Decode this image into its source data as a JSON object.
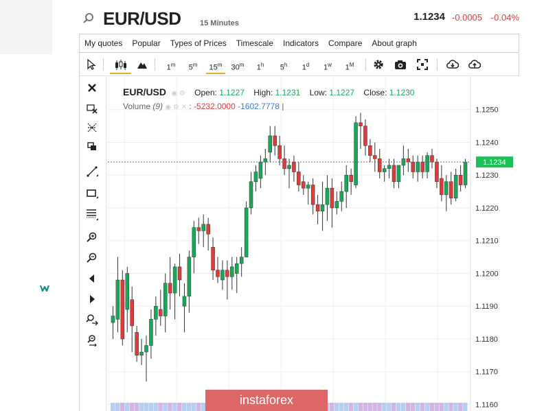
{
  "header": {
    "symbol": "EUR/USD",
    "timeframe": "15 Minutes",
    "price": "1.1234",
    "change": "-0.0005",
    "change_pct": "-0.04%"
  },
  "menu": [
    "My quotes",
    "Popular",
    "Types of Prices",
    "Timescale",
    "Indicators",
    "Compare",
    "About graph"
  ],
  "toolbar": {
    "timeframes": [
      {
        "base": "1",
        "sup": "m"
      },
      {
        "base": "5",
        "sup": "m"
      },
      {
        "base": "15",
        "sup": "m"
      },
      {
        "base": "30",
        "sup": "m"
      },
      {
        "base": "1",
        "sup": "h"
      },
      {
        "base": "5",
        "sup": "h"
      },
      {
        "base": "1",
        "sup": "d"
      },
      {
        "base": "1",
        "sup": "w"
      },
      {
        "base": "1",
        "sup": "M"
      }
    ],
    "active_timeframe": "15m",
    "icons": [
      "cursor-icon",
      "candlestick-icon",
      "mountain-icon",
      "gear-icon",
      "camera-icon",
      "fullscreen-icon",
      "download-icon",
      "upload-icon"
    ]
  },
  "left_tools": [
    "close-icon",
    "erase-icon",
    "crosshair-icon",
    "clone-icon",
    "trendline-icon",
    "rectangle-icon",
    "fibonacci-icon",
    "zoom-in-icon",
    "zoom-out-icon",
    "scroll-left-icon",
    "scroll-right-icon",
    "zoom-in-left-icon",
    "zoom-reset-icon"
  ],
  "legend": {
    "symbol": "EUR/USD",
    "open_label": "Open:",
    "open": "1.1227",
    "high_label": "High:",
    "high": "1.1231",
    "low_label": "Low:",
    "low": "1.1227",
    "close_label": "Close:",
    "close": "1.1230",
    "volume_label": "Volume",
    "volume_param": "(9)",
    "volume_sep": ":",
    "volume_value1": "-5232.0000",
    "volume_value2": "-1602.7778",
    "volume_cursor": "|"
  },
  "watermark": "instaforex",
  "colors": {
    "up": "#1aa75a",
    "down": "#e03a3a",
    "price_tag": "#1fbf58",
    "active_underline": "#e6a935"
  },
  "chart_data": {
    "type": "candlestick",
    "y_ticks": [
      "1.1250",
      "1.1240",
      "1.1230",
      "1.1220",
      "1.1210",
      "1.1200",
      "1.1190",
      "1.1180",
      "1.1170",
      "1.1160"
    ],
    "ylim": [
      1.1158,
      1.126
    ],
    "current_price": "1.1234",
    "grid": true,
    "candles": [
      {
        "o": 1.1185,
        "h": 1.119,
        "l": 1.118,
        "c": 1.1187
      },
      {
        "o": 1.1186,
        "h": 1.1205,
        "l": 1.1182,
        "c": 1.1198
      },
      {
        "o": 1.1198,
        "h": 1.1201,
        "l": 1.1178,
        "c": 1.118
      },
      {
        "o": 1.1189,
        "h": 1.1202,
        "l": 1.1182,
        "c": 1.12
      },
      {
        "o": 1.1192,
        "h": 1.1196,
        "l": 1.1176,
        "c": 1.1184
      },
      {
        "o": 1.1182,
        "h": 1.1184,
        "l": 1.1173,
        "c": 1.1175
      },
      {
        "o": 1.1175,
        "h": 1.118,
        "l": 1.1172,
        "c": 1.1176
      },
      {
        "o": 1.1176,
        "h": 1.1181,
        "l": 1.1167,
        "c": 1.1178
      },
      {
        "o": 1.1178,
        "h": 1.1189,
        "l": 1.1174,
        "c": 1.1186
      },
      {
        "o": 1.1186,
        "h": 1.1193,
        "l": 1.1181,
        "c": 1.119
      },
      {
        "o": 1.1189,
        "h": 1.1195,
        "l": 1.1184,
        "c": 1.1187
      },
      {
        "o": 1.1187,
        "h": 1.12,
        "l": 1.1182,
        "c": 1.1197
      },
      {
        "o": 1.1197,
        "h": 1.1205,
        "l": 1.1189,
        "c": 1.1194
      },
      {
        "o": 1.1194,
        "h": 1.1203,
        "l": 1.1186,
        "c": 1.1202
      },
      {
        "o": 1.1202,
        "h": 1.1206,
        "l": 1.1193,
        "c": 1.1198
      },
      {
        "o": 1.119,
        "h": 1.1197,
        "l": 1.1182,
        "c": 1.1193
      },
      {
        "o": 1.1193,
        "h": 1.1207,
        "l": 1.1188,
        "c": 1.1205
      },
      {
        "o": 1.1205,
        "h": 1.1216,
        "l": 1.12,
        "c": 1.1214
      },
      {
        "o": 1.1214,
        "h": 1.1217,
        "l": 1.1209,
        "c": 1.1213
      },
      {
        "o": 1.1213,
        "h": 1.1218,
        "l": 1.1208,
        "c": 1.1215
      },
      {
        "o": 1.1215,
        "h": 1.1217,
        "l": 1.1207,
        "c": 1.1212
      },
      {
        "o": 1.1208,
        "h": 1.1211,
        "l": 1.1198,
        "c": 1.1201
      },
      {
        "o": 1.1201,
        "h": 1.1205,
        "l": 1.1197,
        "c": 1.1199
      },
      {
        "o": 1.1198,
        "h": 1.1204,
        "l": 1.1195,
        "c": 1.1201
      },
      {
        "o": 1.1201,
        "h": 1.1204,
        "l": 1.1192,
        "c": 1.1199
      },
      {
        "o": 1.1199,
        "h": 1.1205,
        "l": 1.1195,
        "c": 1.1202
      },
      {
        "o": 1.12,
        "h": 1.1205,
        "l": 1.1194,
        "c": 1.1203
      },
      {
        "o": 1.1203,
        "h": 1.1208,
        "l": 1.1199,
        "c": 1.1205
      },
      {
        "o": 1.1205,
        "h": 1.1222,
        "l": 1.1205,
        "c": 1.122
      },
      {
        "o": 1.122,
        "h": 1.1231,
        "l": 1.1218,
        "c": 1.1228
      },
      {
        "o": 1.1228,
        "h": 1.1233,
        "l": 1.1225,
        "c": 1.1231
      },
      {
        "o": 1.1229,
        "h": 1.1236,
        "l": 1.1226,
        "c": 1.1234
      },
      {
        "o": 1.1234,
        "h": 1.1238,
        "l": 1.123,
        "c": 1.1235
      },
      {
        "o": 1.1237,
        "h": 1.1245,
        "l": 1.1234,
        "c": 1.1242
      },
      {
        "o": 1.1242,
        "h": 1.1245,
        "l": 1.1236,
        "c": 1.1239
      },
      {
        "o": 1.1239,
        "h": 1.1242,
        "l": 1.1233,
        "c": 1.1235
      },
      {
        "o": 1.1235,
        "h": 1.1239,
        "l": 1.123,
        "c": 1.1232
      },
      {
        "o": 1.1232,
        "h": 1.1235,
        "l": 1.1226,
        "c": 1.1233
      },
      {
        "o": 1.1234,
        "h": 1.1236,
        "l": 1.1228,
        "c": 1.1231
      },
      {
        "o": 1.1231,
        "h": 1.1234,
        "l": 1.1225,
        "c": 1.1227
      },
      {
        "o": 1.1228,
        "h": 1.123,
        "l": 1.1224,
        "c": 1.1226
      },
      {
        "o": 1.1226,
        "h": 1.1228,
        "l": 1.1221,
        "c": 1.1227
      },
      {
        "o": 1.1227,
        "h": 1.1229,
        "l": 1.1218,
        "c": 1.1221
      },
      {
        "o": 1.1221,
        "h": 1.1224,
        "l": 1.1215,
        "c": 1.1219
      },
      {
        "o": 1.1219,
        "h": 1.1228,
        "l": 1.1213,
        "c": 1.1221
      },
      {
        "o": 1.1221,
        "h": 1.123,
        "l": 1.1216,
        "c": 1.1226
      },
      {
        "o": 1.1226,
        "h": 1.1229,
        "l": 1.1214,
        "c": 1.122
      },
      {
        "o": 1.122,
        "h": 1.1225,
        "l": 1.1218,
        "c": 1.1222
      },
      {
        "o": 1.1222,
        "h": 1.1228,
        "l": 1.1219,
        "c": 1.1225
      },
      {
        "o": 1.1225,
        "h": 1.1233,
        "l": 1.122,
        "c": 1.123
      },
      {
        "o": 1.123,
        "h": 1.1232,
        "l": 1.1224,
        "c": 1.1228
      },
      {
        "o": 1.1227,
        "h": 1.1248,
        "l": 1.1226,
        "c": 1.1246
      },
      {
        "o": 1.1246,
        "h": 1.1249,
        "l": 1.1238,
        "c": 1.1245
      },
      {
        "o": 1.1245,
        "h": 1.1247,
        "l": 1.1236,
        "c": 1.1239
      },
      {
        "o": 1.1239,
        "h": 1.1241,
        "l": 1.1234,
        "c": 1.1236
      },
      {
        "o": 1.1236,
        "h": 1.124,
        "l": 1.1231,
        "c": 1.1235
      },
      {
        "o": 1.1235,
        "h": 1.1238,
        "l": 1.1229,
        "c": 1.1231
      },
      {
        "o": 1.1231,
        "h": 1.1233,
        "l": 1.1228,
        "c": 1.1232
      },
      {
        "o": 1.1232,
        "h": 1.1235,
        "l": 1.1229,
        "c": 1.1233
      },
      {
        "o": 1.1233,
        "h": 1.1235,
        "l": 1.1226,
        "c": 1.1228
      },
      {
        "o": 1.1228,
        "h": 1.1233,
        "l": 1.1226,
        "c": 1.1233
      },
      {
        "o": 1.1233,
        "h": 1.1239,
        "l": 1.123,
        "c": 1.1235
      },
      {
        "o": 1.1235,
        "h": 1.1238,
        "l": 1.1231,
        "c": 1.1234
      },
      {
        "o": 1.1234,
        "h": 1.1236,
        "l": 1.1229,
        "c": 1.1231
      },
      {
        "o": 1.1231,
        "h": 1.1236,
        "l": 1.1228,
        "c": 1.1234
      },
      {
        "o": 1.1234,
        "h": 1.1236,
        "l": 1.1229,
        "c": 1.1231
      },
      {
        "o": 1.1231,
        "h": 1.1237,
        "l": 1.1229,
        "c": 1.1236
      },
      {
        "o": 1.1236,
        "h": 1.1238,
        "l": 1.1232,
        "c": 1.1234
      },
      {
        "o": 1.1234,
        "h": 1.1235,
        "l": 1.1226,
        "c": 1.1228
      },
      {
        "o": 1.1229,
        "h": 1.1233,
        "l": 1.1222,
        "c": 1.1224
      },
      {
        "o": 1.1224,
        "h": 1.123,
        "l": 1.1219,
        "c": 1.1228
      },
      {
        "o": 1.1228,
        "h": 1.1231,
        "l": 1.1221,
        "c": 1.1223
      },
      {
        "o": 1.1223,
        "h": 1.1232,
        "l": 1.1222,
        "c": 1.123
      },
      {
        "o": 1.123,
        "h": 1.1233,
        "l": 1.1225,
        "c": 1.1227
      },
      {
        "o": 1.1227,
        "h": 1.1235,
        "l": 1.1226,
        "c": 1.1234
      }
    ]
  }
}
